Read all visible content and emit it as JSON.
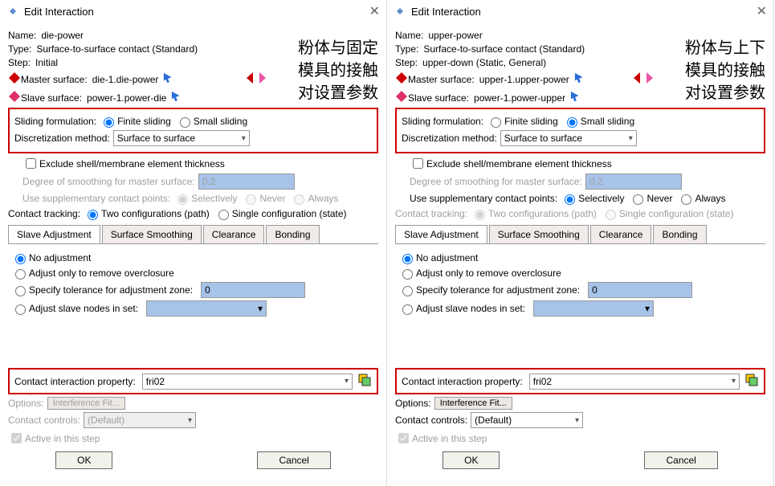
{
  "left": {
    "window_title": "Edit Interaction",
    "annotation": "粉体与固定\n模具的接触\n对设置参数",
    "name_label": "Name:",
    "name_value": "die-power",
    "type_label": "Type:",
    "type_value": "Surface-to-surface contact (Standard)",
    "step_label": "Step:",
    "step_value": "Initial",
    "master_surface_label": "Master surface:",
    "master_surface_value": "die-1.die-power",
    "slave_surface_label": "Slave surface:",
    "slave_surface_value": "power-1.power-die",
    "sliding_label": "Sliding formulation:",
    "sliding_opts": {
      "a": "Finite sliding",
      "b": "Small sliding"
    },
    "sliding_selected": "Finite sliding",
    "disc_label": "Discretization method:",
    "disc_value": "Surface to surface",
    "exclude_label": "Exclude shell/membrane element thickness",
    "smoothing_label": "Degree of smoothing for master surface:",
    "smoothing_value": "0.2",
    "supp_label": "Use supplementary contact points:",
    "supp_opts": {
      "a": "Selectively",
      "b": "Never",
      "c": "Always"
    },
    "supp_enabled": false,
    "tracking_label": "Contact tracking:",
    "tracking_opts": {
      "a": "Two configurations (path)",
      "b": "Single configuration (state)"
    },
    "tracking_selected": "Two configurations (path)",
    "tracking_enabled": true,
    "tabs": {
      "a": "Slave Adjustment",
      "b": "Surface Smoothing",
      "c": "Clearance",
      "d": "Bonding"
    },
    "adjust": {
      "none": "No adjustment",
      "remove": "Adjust only to remove overclosure",
      "tol": "Specify tolerance for adjustment zone:",
      "tol_value": "0",
      "nodes": "Adjust slave nodes in set:"
    },
    "prop_label": "Contact interaction property:",
    "prop_value": "fri02",
    "options_label": "Options:",
    "options_value": "Interference Fit...",
    "options_enabled": false,
    "controls_label": "Contact controls:",
    "controls_value": "(Default)",
    "controls_enabled": false,
    "active_label": "Active in this step",
    "ok": "OK",
    "cancel": "Cancel"
  },
  "right": {
    "window_title": "Edit Interaction",
    "annotation": "粉体与上下\n模具的接触\n对设置参数",
    "name_label": "Name:",
    "name_value": "upper-power",
    "type_label": "Type:",
    "type_value": "Surface-to-surface contact (Standard)",
    "step_label": "Step:",
    "step_value": "upper-down (Static, General)",
    "master_surface_label": "Master surface:",
    "master_surface_value": "upper-1.upper-power",
    "slave_surface_label": "Slave surface:",
    "slave_surface_value": "power-1.power-upper",
    "sliding_label": "Sliding formulation:",
    "sliding_opts": {
      "a": "Finite sliding",
      "b": "Small sliding"
    },
    "sliding_selected": "Small sliding",
    "disc_label": "Discretization method:",
    "disc_value": "Surface to surface",
    "exclude_label": "Exclude shell/membrane element thickness",
    "smoothing_label": "Degree of smoothing for master surface:",
    "smoothing_value": "0.2",
    "supp_label": "Use supplementary contact points:",
    "supp_opts": {
      "a": "Selectively",
      "b": "Never",
      "c": "Always"
    },
    "supp_enabled": true,
    "tracking_label": "Contact tracking:",
    "tracking_opts": {
      "a": "Two configurations (path)",
      "b": "Single configuration (state)"
    },
    "tracking_enabled": false,
    "tabs": {
      "a": "Slave Adjustment",
      "b": "Surface Smoothing",
      "c": "Clearance",
      "d": "Bonding"
    },
    "adjust": {
      "none": "No adjustment",
      "remove": "Adjust only to remove overclosure",
      "tol": "Specify tolerance for adjustment zone:",
      "tol_value": "0",
      "nodes": "Adjust slave nodes in set:"
    },
    "prop_label": "Contact interaction property:",
    "prop_value": "fri02",
    "options_label": "Options:",
    "options_value": "Interference Fit...",
    "options_enabled": true,
    "controls_label": "Contact controls:",
    "controls_value": "(Default)",
    "controls_enabled": true,
    "active_label": "Active in this step",
    "ok": "OK",
    "cancel": "Cancel"
  }
}
